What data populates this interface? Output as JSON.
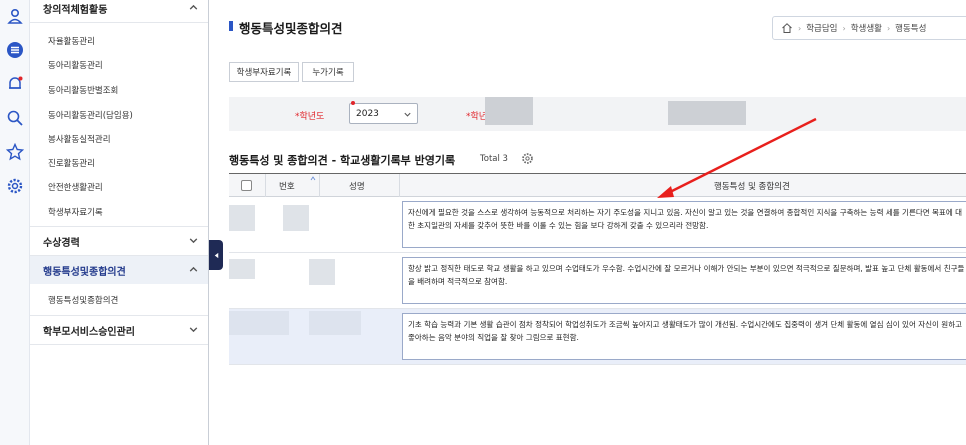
{
  "rail": [
    "home-icon",
    "menu-icon",
    "bell-icon",
    "search-icon",
    "star-icon",
    "settings-icon"
  ],
  "menu": {
    "section1": "창의적체험활동",
    "section1_items": [
      "자율활동관리",
      "동아리활동관리",
      "동아리활동반별조회",
      "동아리활동관리(담임용)",
      "봉사활동실적관리",
      "진로활동관리",
      "안전한생활관리",
      "학생부자료기록"
    ],
    "section2": "수상경력",
    "section3": "행동특성및종합의견",
    "section3_items": [
      "행동특성및종합의견"
    ],
    "section4": "학부모서비스승인관리"
  },
  "page": {
    "title": "행동특성및종합의견",
    "breadcrumb": [
      "학급담임",
      "학생생활",
      "행동특성"
    ]
  },
  "tabs": [
    "학생부자료기록",
    "누가기록"
  ],
  "filter": {
    "year_label": "*학년도",
    "year_value": "2023",
    "second_label": "*학년"
  },
  "list": {
    "title": "행동특성 및 종합의견 - 학교생활기록부 반영기록",
    "total": "Total 3",
    "columns": [
      "번호",
      "성명",
      "행동특성 및 종합의견"
    ],
    "rows": [
      {
        "text": "자신에게 필요한 것을 스스로 생각하여 능동적으로 처리하는 자기 주도성을 지니고 있음. 자신이 알고 있는 것을 연결하여 종합적인 지식을 구축하는 능력 세를 기른다면 목표에 대한 초지일관의 자세를 갖추어 뜻한 바를 이룰 수 있는 힘을 보다 강하게 갖출 수 있으리라 전망함."
      },
      {
        "text": "항상 밝고 정직한 태도로 학교 생활을 하고 있으며 수업태도가 우수함. 수업시간에 잘 모르거나 이해가 안되는 부분이 있으면 적극적으로 질문하며, 발표 높고 단체 활동에서 친구들을 배려하며 적극적으로 참여함."
      },
      {
        "text": "기초 학습 능력과 기본 생활 습관이 점차 정착되어 학업성취도가 조금씩 높아지고 생활태도가 많이 개선됨. 수업시간에도 집중력이 생겨 단체 활동에 열심 심이 있어 자신이 원하고 좋아하는 음악 분야의 직업을 잘 찾아 그림으로 표현함."
      }
    ]
  },
  "colors": {
    "accent": "#2b56c5",
    "required": "#e1262c",
    "annotation": "#e8201d"
  }
}
